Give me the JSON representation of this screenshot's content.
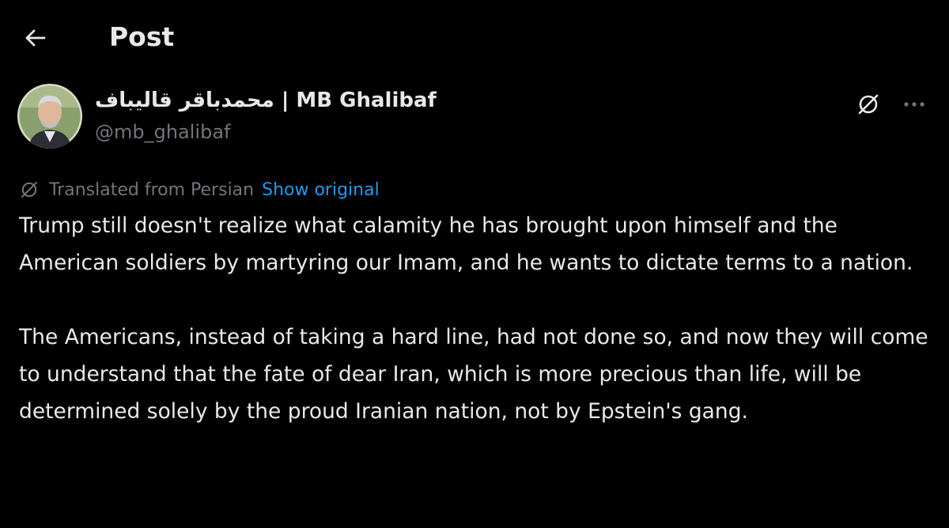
{
  "header": {
    "title": "Post",
    "back_icon": "arrow-left-icon"
  },
  "author": {
    "display_name": "محمدباقر قالیباف | MB Ghalibaf",
    "handle": "@mb_ghalibaf",
    "avatar_icon": "avatar-photo"
  },
  "actions": {
    "grok_icon": "grok-icon",
    "more_icon": "more-options-icon"
  },
  "translation": {
    "label": "Translated from Persian",
    "show_original": "Show original",
    "icon": "grok-icon"
  },
  "post": {
    "paragraphs": [
      "Trump still doesn't realize what calamity he has brought upon himself and the American soldiers by martyring our Imam, and he wants to dictate terms to a nation.",
      "The Americans, instead of taking a hard line, had not done so, and now they will come to understand that the fate of dear Iran, which is more precious than life, will be determined solely by the proud Iranian nation, not by Epstein's gang."
    ]
  },
  "colors": {
    "background": "#000000",
    "text_primary": "#e7e9ea",
    "text_secondary": "#71767b",
    "link": "#1d9bf0"
  }
}
